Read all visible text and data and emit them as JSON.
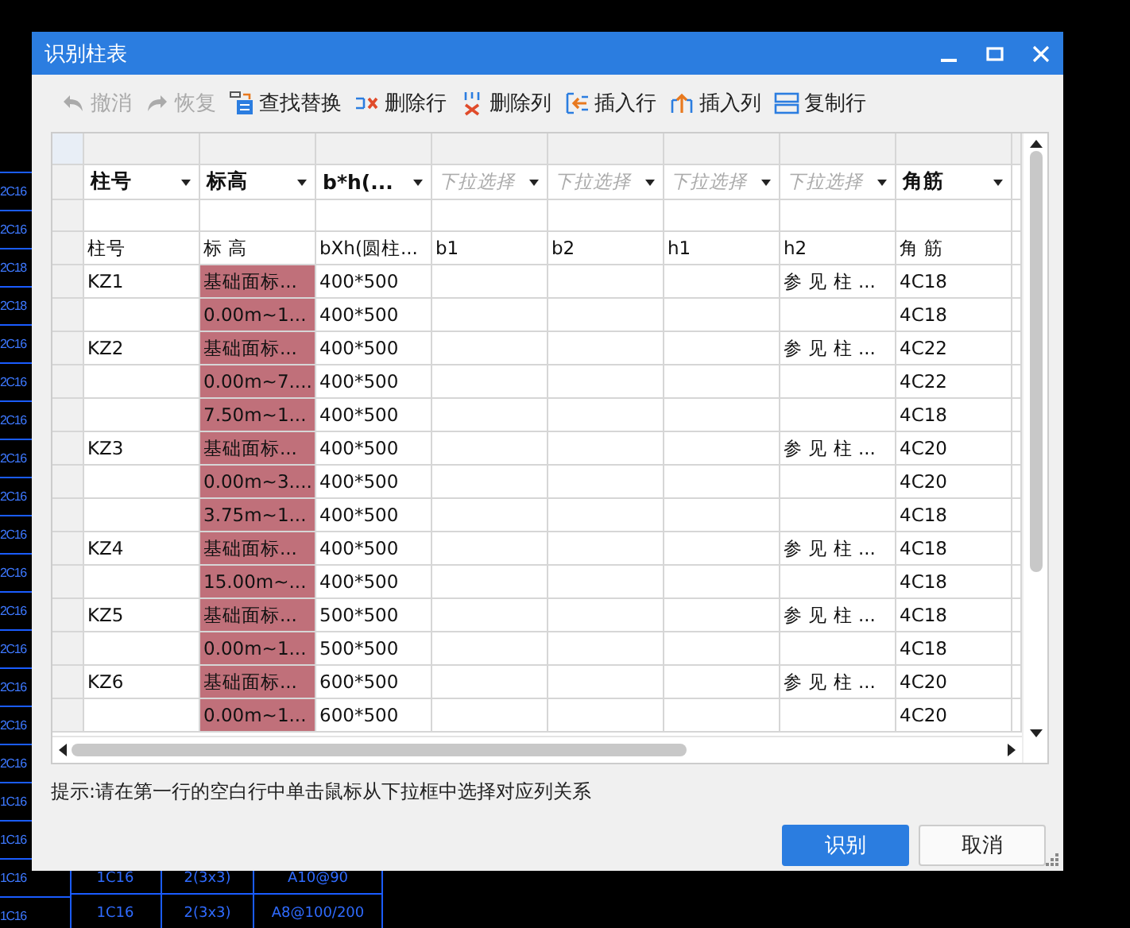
{
  "background": {
    "side_labels": [
      "2C16",
      "2C16",
      "2C18",
      "2C18",
      "2C16",
      "2C16",
      "2C16",
      "2C16",
      "2C16",
      "2C16",
      "2C16",
      "2C16",
      "2C16",
      "2C16",
      "2C16",
      "2C16",
      "1C16",
      "1C16",
      "1C16",
      "1C16"
    ],
    "bottom_rows": [
      [
        "1C16",
        "2(3x3)",
        "A10@90"
      ],
      [
        "1C16",
        "2(3x3)",
        "A8@100/200"
      ]
    ]
  },
  "window": {
    "title": "识别柱表"
  },
  "toolbar": [
    {
      "kind": "undo",
      "label": "撤消",
      "disabled": true
    },
    {
      "kind": "redo",
      "label": "恢复",
      "disabled": true
    },
    {
      "kind": "find",
      "label": "查找替换",
      "disabled": false
    },
    {
      "kind": "delrow",
      "label": "删除行",
      "disabled": false
    },
    {
      "kind": "delcol",
      "label": "删除列",
      "disabled": false
    },
    {
      "kind": "insrow",
      "label": "插入行",
      "disabled": false
    },
    {
      "kind": "inscol",
      "label": "插入列",
      "disabled": false
    },
    {
      "kind": "copyrow",
      "label": "复制行",
      "disabled": false
    }
  ],
  "table": {
    "columns": [
      {
        "value": "柱号"
      },
      {
        "value": "标高"
      },
      {
        "value": "b*h(..."
      },
      {
        "placeholder": "下拉选择"
      },
      {
        "placeholder": "下拉选择"
      },
      {
        "placeholder": "下拉选择"
      },
      {
        "placeholder": "下拉选择"
      },
      {
        "value": "角筋"
      }
    ],
    "rows": [
      {
        "id": "柱号",
        "elevation": "标 高",
        "highlighted": false,
        "bxh": "bXh(圆柱...",
        "b1": "b1",
        "b2": "b2",
        "h1": "h1",
        "h2": "h2",
        "corner": "角 筋"
      },
      {
        "id": "KZ1",
        "elevation": "基础面标...",
        "highlighted": true,
        "bxh": "400*500",
        "h2": "参 见 柱 ...",
        "corner": "4C18"
      },
      {
        "elevation": "0.00m~1...",
        "highlighted": true,
        "bxh": "400*500",
        "corner": "4C18"
      },
      {
        "id": "KZ2",
        "elevation": "基础面标...",
        "highlighted": true,
        "bxh": "400*500",
        "h2": "参 见 柱 ...",
        "corner": "4C22"
      },
      {
        "elevation": "0.00m~7....",
        "highlighted": true,
        "bxh": "400*500",
        "corner": "4C22"
      },
      {
        "elevation": "7.50m~1...",
        "highlighted": true,
        "bxh": "400*500",
        "corner": "4C18"
      },
      {
        "id": "KZ3",
        "elevation": "基础面标...",
        "highlighted": true,
        "bxh": "400*500",
        "h2": "参 见 柱 ...",
        "corner": "4C20"
      },
      {
        "elevation": "0.00m~3....",
        "highlighted": true,
        "bxh": "400*500",
        "corner": "4C20"
      },
      {
        "elevation": "3.75m~1...",
        "highlighted": true,
        "bxh": "400*500",
        "corner": "4C18"
      },
      {
        "id": "KZ4",
        "elevation": "基础面标...",
        "highlighted": true,
        "bxh": "400*500",
        "h2": "参 见 柱 ...",
        "corner": "4C18"
      },
      {
        "elevation": "15.00m~...",
        "highlighted": true,
        "bxh": "400*500",
        "corner": "4C18"
      },
      {
        "id": "KZ5",
        "elevation": "基础面标...",
        "highlighted": true,
        "bxh": "500*500",
        "h2": "参 见 柱 ...",
        "corner": "4C18"
      },
      {
        "elevation": "0.00m~1...",
        "highlighted": true,
        "bxh": "500*500",
        "corner": "4C18"
      },
      {
        "id": "KZ6",
        "elevation": "基础面标...",
        "highlighted": true,
        "bxh": "600*500",
        "h2": "参 见 柱 ...",
        "corner": "4C20"
      },
      {
        "elevation": "0.00m~1...",
        "highlighted": true,
        "bxh": "600*500",
        "corner": "4C20"
      }
    ]
  },
  "hint": "提示:请在第一行的空白行中单击鼠标从下拉框中选择对应列关系",
  "buttons": [
    {
      "kind": "primary",
      "label": "识别"
    },
    {
      "kind": "secondary",
      "label": "取消"
    }
  ]
}
